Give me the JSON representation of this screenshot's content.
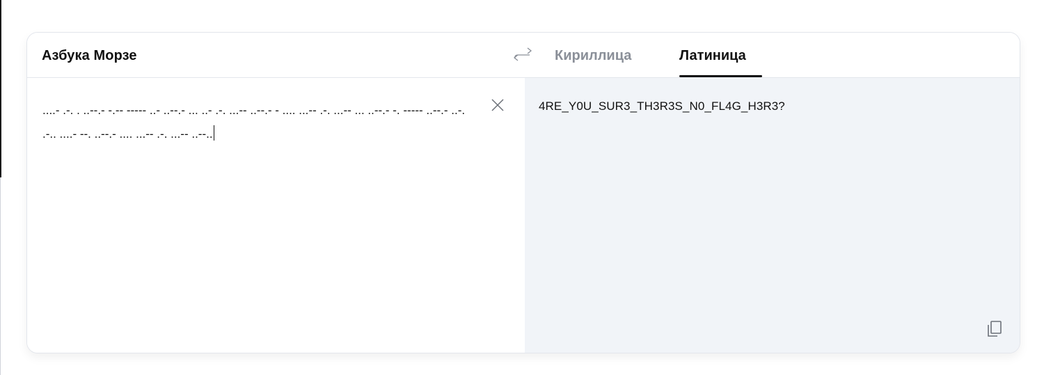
{
  "header": {
    "source_language": "Азбука Морзе",
    "swap_icon": "swap-arrows-icon",
    "tabs": [
      {
        "label": "Кириллица",
        "active": false
      },
      {
        "label": "Латиница",
        "active": true
      }
    ]
  },
  "input": {
    "value": "....- .-. . ..--.- -.-- ----- ..- ..--.- ... ..- .-. ...-- ..--.- - .... ...-- .-. ...-- ... ..--.- -. ----- ..--.- ..-. .-.. ....- --. ..--.- .... ...-- .-. ...-- ..--..",
    "clear_icon": "close-icon"
  },
  "output": {
    "value": "4RE_Y0U_SUR3_TH3R3S_N0_FL4G_H3R3?",
    "copy_icon": "copy-icon"
  },
  "colors": {
    "text": "#111111",
    "inactive_tab": "#8a8f98",
    "output_background": "#f1f4f8",
    "border": "#e3e6ec"
  }
}
